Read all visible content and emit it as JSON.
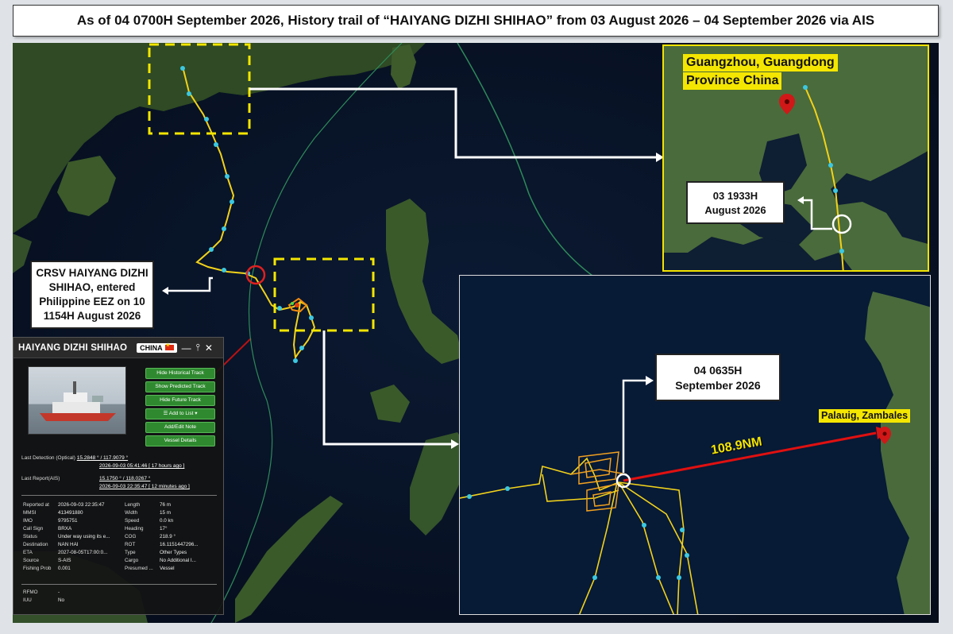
{
  "title": "As of 04 0700H September 2026, History trail of “HAIYANG DIZHI SHIHAO” from 03 August 2026 – 04 September 2026 via AIS",
  "callouts": {
    "eez": "CRSV HAIYANG DIZHI SHIHAO, entered Philippine EEZ on 10 1154H August 2026",
    "start_time_line1": "03 1933H",
    "start_time_line2": "August 2026",
    "latest_time_line1": "04 0635H",
    "latest_time_line2": "September 2026"
  },
  "labels": {
    "guangzhou_line1": "Guangzhou, Guangdong",
    "guangzhou_line2": "Province China",
    "palauig": "Palauig, Zambales",
    "distance": "108.9NM"
  },
  "colors": {
    "track": "#f2d21a",
    "waypoint": "#3cc8e0",
    "highlight_box": "#f4e600",
    "distance_line": "#e01010",
    "ring_eez": "#e02020"
  },
  "vessel_panel": {
    "name": "HAIYANG DIZHI SHIHAO",
    "flag": "CHINA",
    "buttons": [
      "Hide Historical Track",
      "Show Predicted Track",
      "Hide Future Track",
      "☰ Add to List ▾",
      "Add/Edit Note",
      "Vessel Details"
    ],
    "last_detection_label": "Last Detection (Optical)",
    "last_detection_pos": "15.2848 ° / 117.9079 °",
    "last_detection_time": "2026-09-03 05:41:46 [ 17 hours ago ]",
    "last_report_label": "Last Report(AIS)",
    "last_report_pos": "15.1750 ° / 118.0267 °",
    "last_report_time": "2026-09-03 22:35:47 [ 12 minutes ago ]",
    "rows": [
      {
        "k1": "Reported at",
        "v1": "2026-09-03 22:35:47",
        "k2": "Length",
        "v2": "76 m"
      },
      {
        "k1": "MMSI",
        "v1": "413491880",
        "k2": "Width",
        "v2": "15 m"
      },
      {
        "k1": "IMO",
        "v1": "9795751",
        "k2": "Speed",
        "v2": "0.0 kn"
      },
      {
        "k1": "Call Sign",
        "v1": "BRXA",
        "k2": "Heading",
        "v2": "17°"
      },
      {
        "k1": "Status",
        "v1": "Under way using its e...",
        "k2": "COG",
        "v2": "218.9 °"
      },
      {
        "k1": "Destination",
        "v1": "NAN HAI",
        "k2": "ROT",
        "v2": "16.1151447296..."
      },
      {
        "k1": "ETA",
        "v1": "2027-08-05T17:00:0...",
        "k2": "Type",
        "v2": "Other Types"
      },
      {
        "k1": "Source",
        "v1": "S-AIS",
        "k2": "Cargo",
        "v2": "No Additional I..."
      },
      {
        "k1": "Fishing Prob",
        "v1": "0.001",
        "k2": "Presumed ...",
        "v2": "Vessel"
      }
    ],
    "rfmo_label": "RFMO",
    "rfmo_value": "-",
    "iuu_label": "IUU",
    "iuu_value": "No"
  }
}
